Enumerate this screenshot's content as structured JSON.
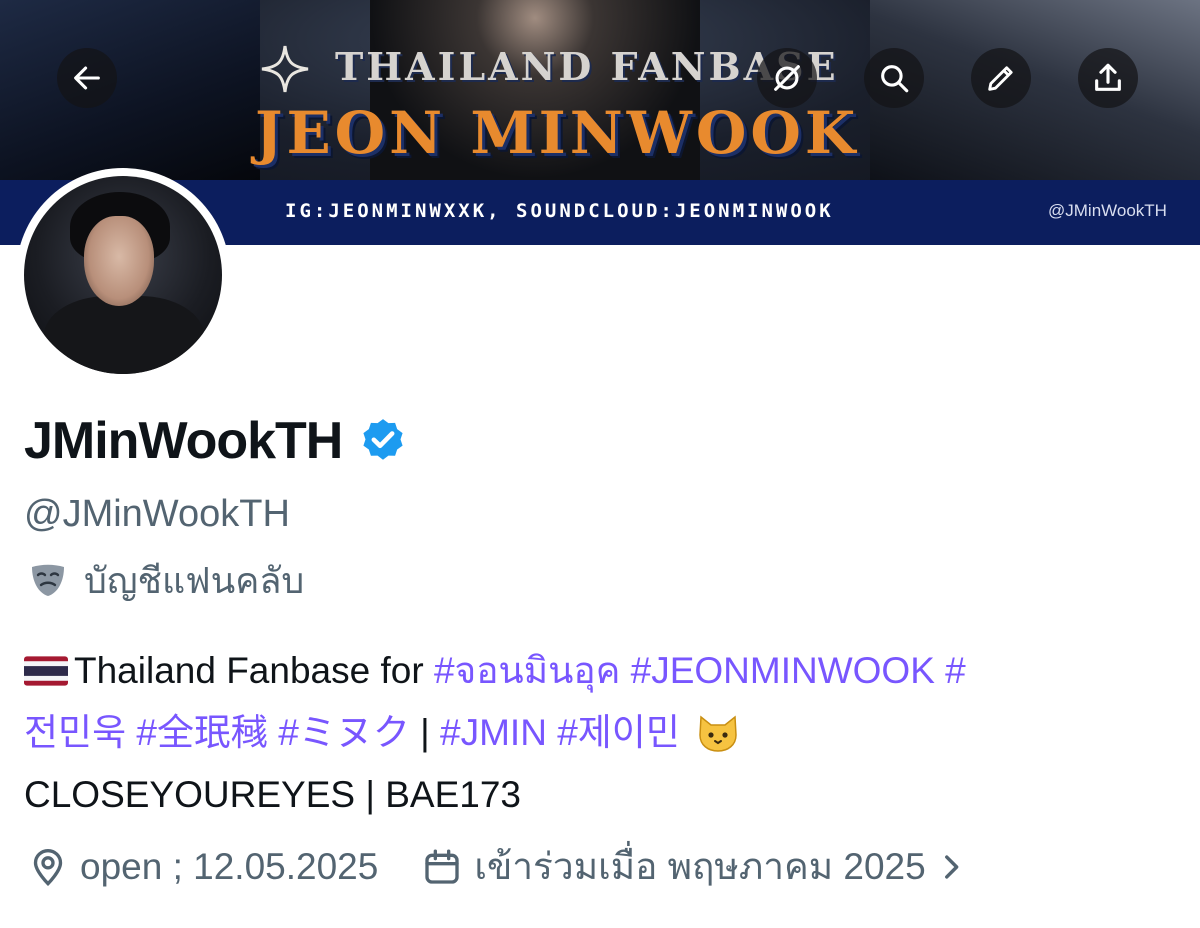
{
  "banner": {
    "title_small": "THAILAND FANBASE",
    "title_big": "JEON MINWOOK",
    "strip_text": "IG:JEONMINWXXK, SOUNDCLOUD:JEONMINWOOK",
    "strip_handle": "@JMinWookTH"
  },
  "toolbar": {
    "icons": [
      "back-arrow-icon",
      "grok-icon",
      "search-icon",
      "edit-icon",
      "share-icon"
    ]
  },
  "profile": {
    "display_name": "JMinWookTH",
    "verified": true,
    "handle": "@JMinWookTH",
    "affiliation": "บัญชีแฟนคลับ",
    "bio": {
      "line1_prefix": "Thailand Fanbase for ",
      "line1_tags": "#จอนมินอุค #JEONMINWOOK #",
      "line2_tags_a": "전민욱 #全珉稶 #ミヌク",
      "line2_sep": " | ",
      "line2_tags_b": "#JMIN #제이민",
      "line3": "CLOSEYOUREYES | BAE173"
    },
    "location": "open ; 12.05.2025",
    "joined": "เข้าร่วมเมื่อ พฤษภาคม 2025"
  },
  "colors": {
    "link": "#7856ff",
    "secondary_text": "#536471",
    "verified_blue": "#1d9bf0",
    "banner_strip": "#0c1e5e",
    "banner_orange": "#e88a2e"
  }
}
